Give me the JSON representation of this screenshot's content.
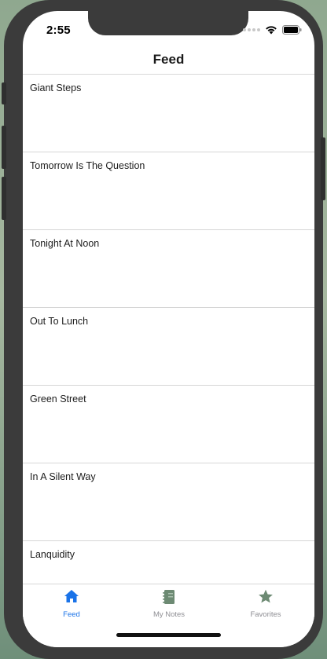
{
  "status_bar": {
    "time": "2:55"
  },
  "nav": {
    "title": "Feed"
  },
  "feed": {
    "items": [
      {
        "title": "Giant Steps"
      },
      {
        "title": "Tomorrow Is The Question"
      },
      {
        "title": "Tonight At Noon"
      },
      {
        "title": "Out To Lunch"
      },
      {
        "title": "Green Street"
      },
      {
        "title": "In A Silent Way"
      },
      {
        "title": "Lanquidity"
      }
    ]
  },
  "tabbar": {
    "tabs": [
      {
        "label": "Feed",
        "icon": "home-icon",
        "active": true
      },
      {
        "label": "My Notes",
        "icon": "notebook-icon",
        "active": false
      },
      {
        "label": "Favorites",
        "icon": "star-icon",
        "active": false
      }
    ],
    "active_color": "#1a73e8",
    "inactive_color": "#8e8e93",
    "inactive_icon_color": "#6d8a73"
  }
}
